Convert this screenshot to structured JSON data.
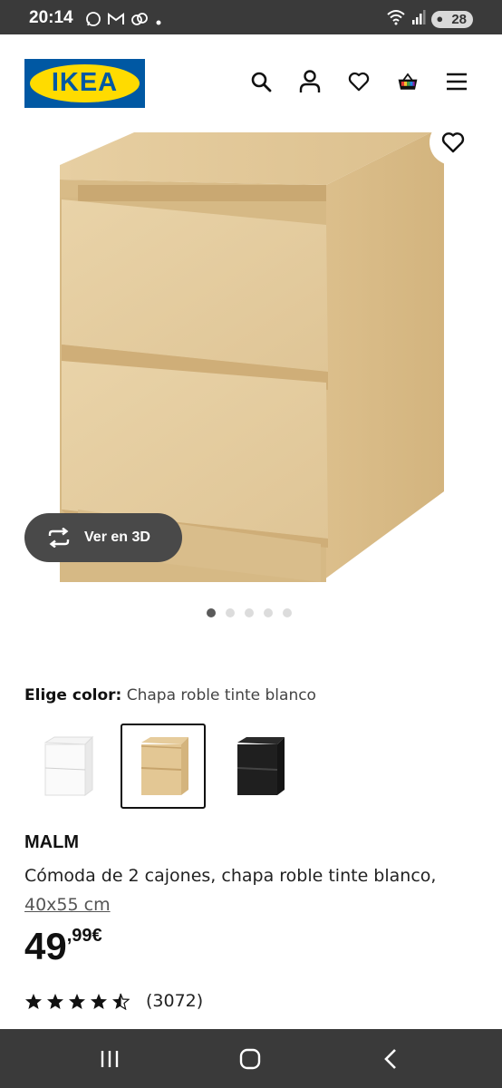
{
  "status_bar": {
    "time": "20:14",
    "battery": "28",
    "icons": [
      "whatsapp-icon",
      "gmail-icon",
      "cloud-icon",
      "dot-icon",
      "wifi-icon",
      "signal-icon",
      "battery-icon"
    ]
  },
  "header": {
    "logo_text": "IKEA",
    "icons": [
      "search-icon",
      "account-icon",
      "wishlist-icon",
      "cart-icon",
      "menu-icon"
    ]
  },
  "gallery": {
    "view_3d_label": "Ver en 3D",
    "slide_count": 5,
    "active_slide": 1
  },
  "color_selector": {
    "label": "Elige color:",
    "selected_value": "Chapa roble tinte blanco",
    "options": [
      "white",
      "oak",
      "black"
    ],
    "selected_index": 1
  },
  "product": {
    "name": "MALM",
    "description": "Cómoda de 2 cajones, chapa roble tinte blanco,",
    "size": "40x55 cm",
    "price_int": "49",
    "price_dec": ",99€",
    "rating_stars": 4.5,
    "review_count": "(3072)"
  },
  "colors": {
    "ikea_blue": "#0058a3",
    "ikea_yellow": "#ffdb00",
    "oak": "#e2c99a",
    "dark_pill": "#494949"
  }
}
